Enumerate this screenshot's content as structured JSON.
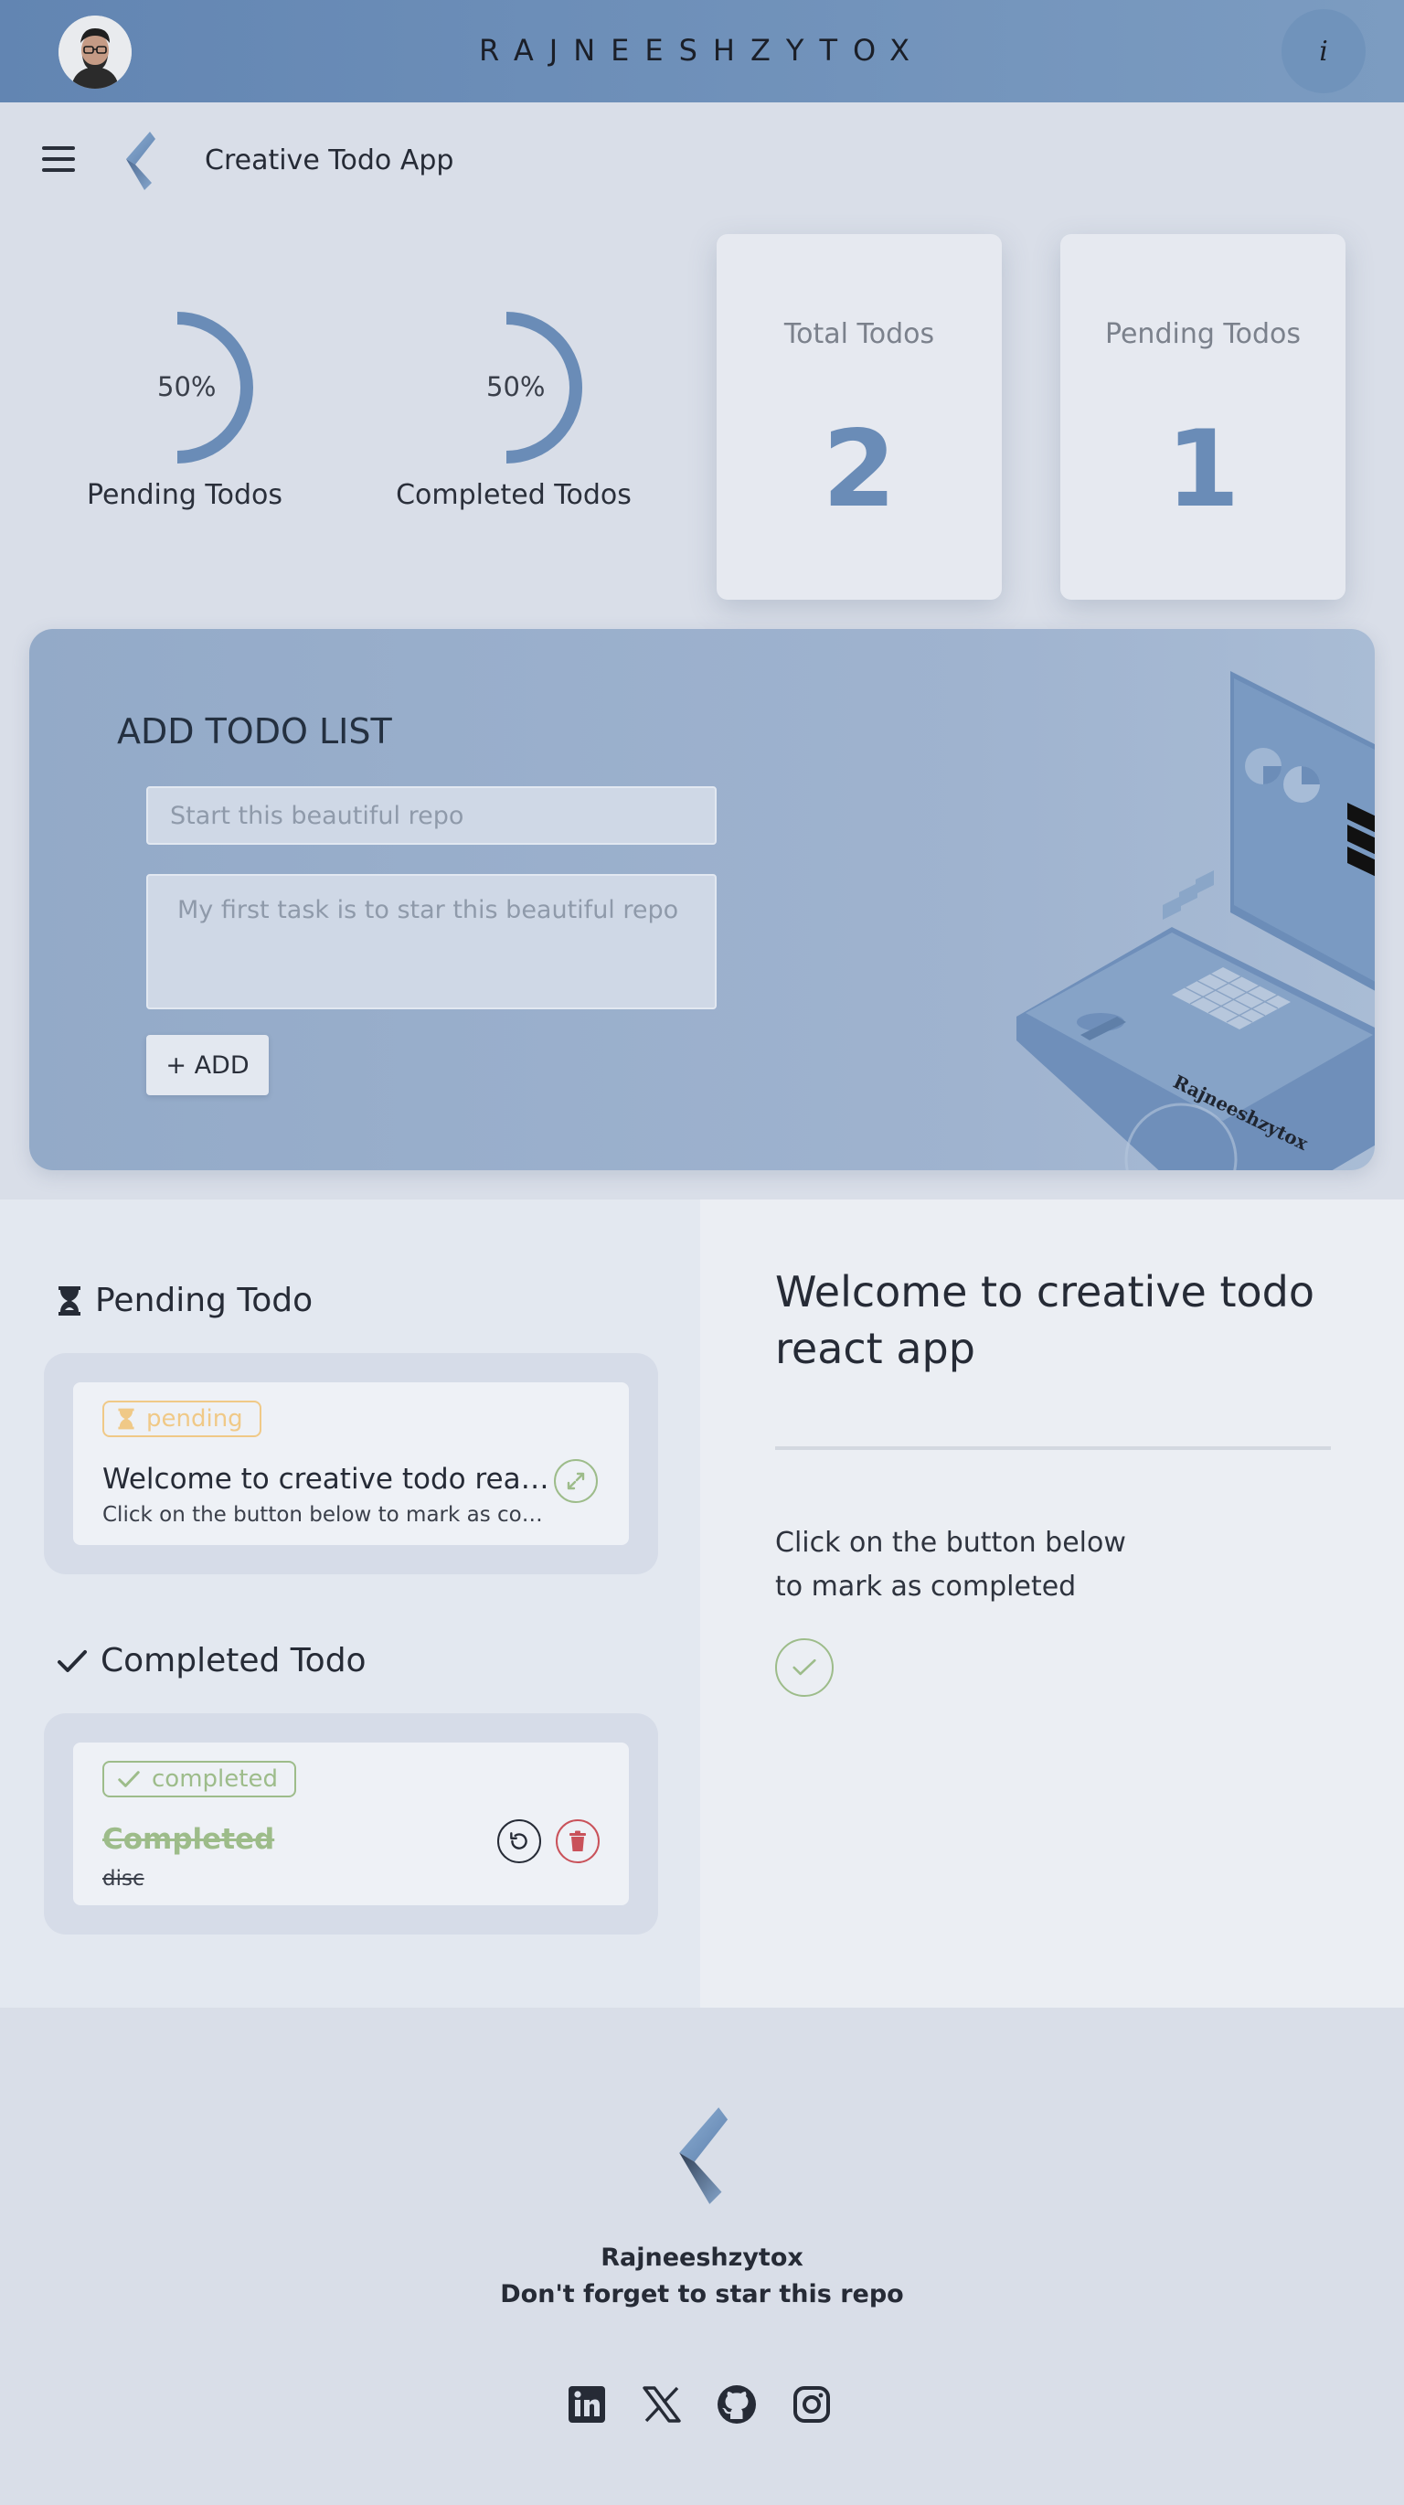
{
  "topbar": {
    "title": "RAJNEESHZYTOX",
    "info_label": "i"
  },
  "header": {
    "app_title": "Creative Todo App"
  },
  "stats": {
    "pending_ring": {
      "percent_label": "50%",
      "label": "Pending Todos",
      "value": 50
    },
    "completed_ring": {
      "percent_label": "50%",
      "label": "Completed Todos",
      "value": 50
    },
    "total_card": {
      "title": "Total Todos",
      "value": "2"
    },
    "pending_card": {
      "title": "Pending Todos",
      "value": "1"
    }
  },
  "add_panel": {
    "title": "ADD TODO LIST",
    "title_placeholder": "Start this beautiful repo",
    "desc_placeholder": "My first task is to star this beautiful repo",
    "add_label": "+ ADD",
    "illustration_text": "Rajneeshzytox"
  },
  "pending_section": {
    "heading": "Pending Todo",
    "items": [
      {
        "badge": "pending",
        "title": "Welcome to creative todo react app",
        "desc": "Click on the button below to mark as completed"
      }
    ]
  },
  "completed_section": {
    "heading": "Completed Todo",
    "items": [
      {
        "badge": "completed",
        "title": "Completed",
        "desc": "disc"
      }
    ]
  },
  "detail": {
    "title": "Welcome to creative todo react app",
    "desc": "Click on the button below to mark as completed"
  },
  "footer": {
    "name": "Rajneeshzytox",
    "tagline": "Don't forget to star this repo",
    "socials": [
      "linkedin-icon",
      "x-icon",
      "github-icon",
      "instagram-icon"
    ]
  },
  "colors": {
    "accent": "#6a8cb7",
    "pending": "#f0c987",
    "completed": "#9dbc8a",
    "danger": "#c9525a"
  }
}
